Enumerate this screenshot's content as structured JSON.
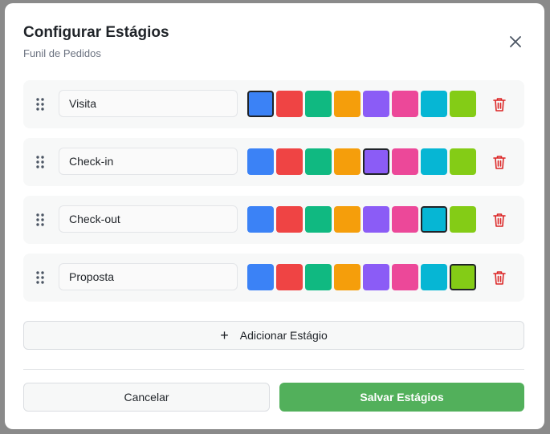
{
  "dialog": {
    "title": "Configurar Estágios",
    "subtitle": "Funil de Pedidos",
    "close_icon": "close-icon"
  },
  "palette": [
    "#3b82f6",
    "#ef4444",
    "#10b981",
    "#f59e0b",
    "#8b5cf6",
    "#ec4899",
    "#06b6d4",
    "#84cc16"
  ],
  "stages": [
    {
      "name": "Visita",
      "selected_color": "#3b82f6"
    },
    {
      "name": "Check-in",
      "selected_color": "#8b5cf6"
    },
    {
      "name": "Check-out",
      "selected_color": "#06b6d4"
    },
    {
      "name": "Proposta",
      "selected_color": "#84cc16"
    }
  ],
  "actions": {
    "add_label": "Adicionar Estágio",
    "cancel_label": "Cancelar",
    "save_label": "Salvar Estágios"
  },
  "colors": {
    "save_button": "#52b05b",
    "delete_icon": "#dc2626",
    "selected_border": "#1f2328"
  },
  "icons": {
    "drag": "drag-handle-icon",
    "delete": "trash-icon",
    "add": "plus-icon"
  }
}
